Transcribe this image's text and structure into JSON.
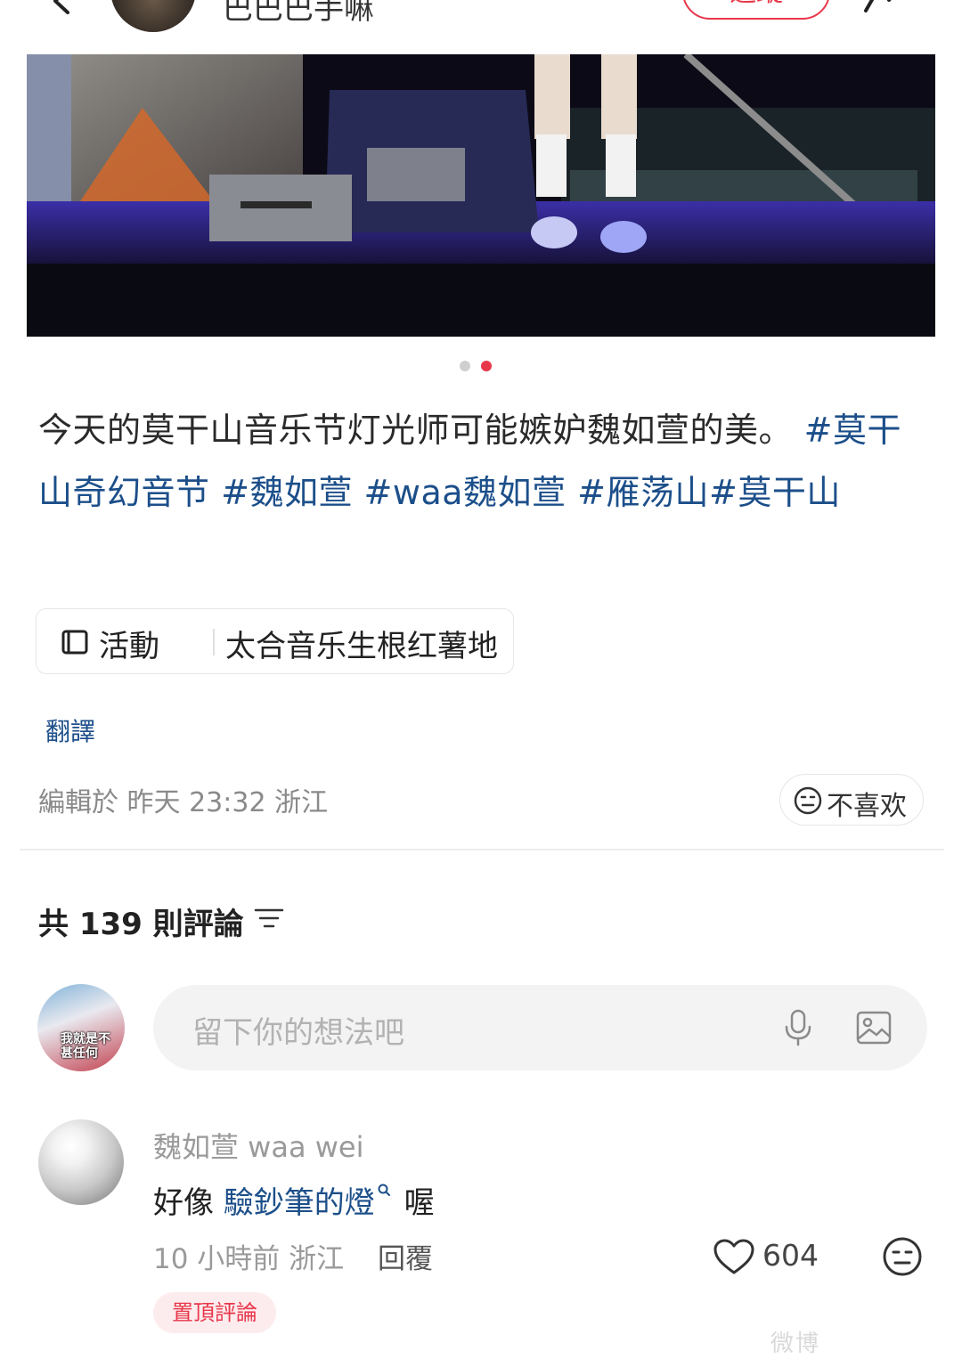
{
  "header": {
    "author_name": "巴巴巴手嘛",
    "follow_label": "追蹤"
  },
  "gallery": {
    "total_dots": 2,
    "active_index": 1
  },
  "post": {
    "caption_text": "今天的莫干山音乐节灯光师可能嫉妒魏如萱的美。",
    "hashtags": [
      "#莫干山奇幻音节",
      "#魏如萱",
      "#waa魏如萱",
      "#雁荡山",
      "#莫干山"
    ],
    "activity_label": "活動",
    "activity_name": "太合音乐生根红薯地",
    "translate_label": "翻譯",
    "edit_meta": "編輯於 昨天 23:32 浙江",
    "dislike_label": "不喜欢"
  },
  "comments_section": {
    "count_label": "共 139 則評論",
    "input_placeholder": "留下你的想法吧",
    "my_avatar_text": "我就是不甚任何"
  },
  "comment": {
    "author": "魏如萱 waa wei",
    "text_prefix": "好像 ",
    "text_link": "驗鈔筆的燈",
    "text_suffix": " 喔",
    "meta": "10 小時前  浙江",
    "reply_label": "回覆",
    "like_count": "604",
    "pinned_label": "置頂評論"
  },
  "icons": [
    "back-icon",
    "share-icon",
    "activity-icon",
    "dislike-icon",
    "sort-icon",
    "mic-icon",
    "image-icon",
    "search-icon",
    "heart-icon"
  ],
  "colors": {
    "accent": "#e8374a",
    "link": "#1c4f8a",
    "meta": "#9a9a9a"
  },
  "watermark": "微博"
}
